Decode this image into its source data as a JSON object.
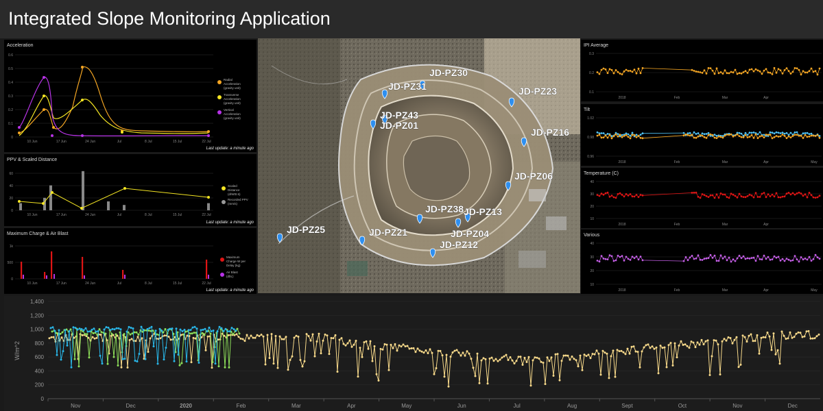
{
  "app": {
    "title": "Integrated Slope Monitoring Application",
    "last_update": "Last update: a minute ago"
  },
  "panels": {
    "acceleration": {
      "title": "Acceleration",
      "yticks": [
        "0.6",
        "0.5",
        "0.4",
        "0.3",
        "0.2",
        "0.1",
        "0"
      ],
      "xticks": [
        "10 Jun",
        "17 Jun",
        "24 Jun",
        "Jul",
        "8 Jul",
        "15 Jul",
        "22 Jul"
      ],
      "legend": [
        {
          "label": "Radial Acceleration (gravity unit)",
          "color": "#f5a623"
        },
        {
          "label": "Transverse Acceleration (gravity unit)",
          "color": "#f5e623"
        },
        {
          "label": "Vertical Acceleration (gravity unit)",
          "color": "#b733e6"
        }
      ]
    },
    "ppv": {
      "title": "PPV & Scaled Distance",
      "yticks": [
        "60",
        "40",
        "20",
        "0"
      ],
      "xticks": [
        "10 Jun",
        "17 Jun",
        "24 Jun",
        "Jul",
        "8 Jul",
        "15 Jul",
        "22 Jul"
      ],
      "legend": [
        {
          "label": "Scaled Distance (d/Wt0.5)",
          "color": "#f5e623"
        },
        {
          "label": "Recorded PPV (mm/s)",
          "color": "#999999"
        }
      ]
    },
    "charge": {
      "title": "Maximum Charge & Air Blast",
      "yticks": [
        "1k",
        "500",
        "0"
      ],
      "xticks": [
        "10 Jun",
        "17 Jun",
        "24 Jun",
        "Jul",
        "8 Jul",
        "15 Jul",
        "22 Jul"
      ],
      "legend": [
        {
          "label": "Maximum Charge W per Delay (kg)",
          "color": "#e01515"
        },
        {
          "label": "Air Blast (dbL)",
          "color": "#b733e6"
        }
      ]
    },
    "ipi": {
      "title": "IPI Average",
      "yticks": [
        "0.3",
        "0.2",
        "0.1"
      ],
      "xticks": [
        "2018",
        "Feb",
        "Mar",
        "Apr"
      ],
      "color": "#f5a623"
    },
    "tilt": {
      "title": "Tilt",
      "yticks": [
        "1.02",
        "0.98",
        "0.96"
      ],
      "xticks": [
        "2018",
        "Feb",
        "Mar",
        "Apr",
        "May"
      ],
      "color": "#4fc3f7",
      "color2": "#f5a623"
    },
    "temperature": {
      "title": "Temperature (C)",
      "yticks": [
        "40",
        "30",
        "20",
        "10"
      ],
      "xticks": [
        "2018",
        "Feb",
        "Mar",
        "Apr"
      ],
      "color": "#e01515"
    },
    "various": {
      "title": "Various",
      "yticks": [
        "40",
        "30",
        "20",
        "10"
      ],
      "xticks": [
        "2018",
        "Feb",
        "Mar",
        "Apr",
        "May"
      ],
      "color": "#c45ee6"
    }
  },
  "map": {
    "pins": [
      {
        "id": "JD-PZ30"
      },
      {
        "id": "JD-PZ31"
      },
      {
        "id": "JD-PZ23"
      },
      {
        "id": "JD-PZ43"
      },
      {
        "id": "JD-PZ01"
      },
      {
        "id": "JD-PZ16"
      },
      {
        "id": "JD-PZ06"
      },
      {
        "id": "JD-PZ38"
      },
      {
        "id": "JD-PZ13"
      },
      {
        "id": "JD-PZ25"
      },
      {
        "id": "JD-PZ21"
      },
      {
        "id": "JD-PZ04"
      },
      {
        "id": "JD-PZ12"
      }
    ]
  },
  "bottom_chart": {
    "ylabel": "W/m^2",
    "yticks": [
      "1,400",
      "1,200",
      "1,000",
      "800",
      "600",
      "400",
      "200",
      "0"
    ],
    "xticks": [
      "Nov",
      "Dec",
      "2020",
      "Feb",
      "Mar",
      "Apr",
      "May",
      "Jun",
      "Jul",
      "Aug",
      "Sept",
      "Oct",
      "Nov",
      "Dec"
    ],
    "colors": [
      "#f7d98a",
      "#8ee05a",
      "#29b6e8"
    ]
  }
}
